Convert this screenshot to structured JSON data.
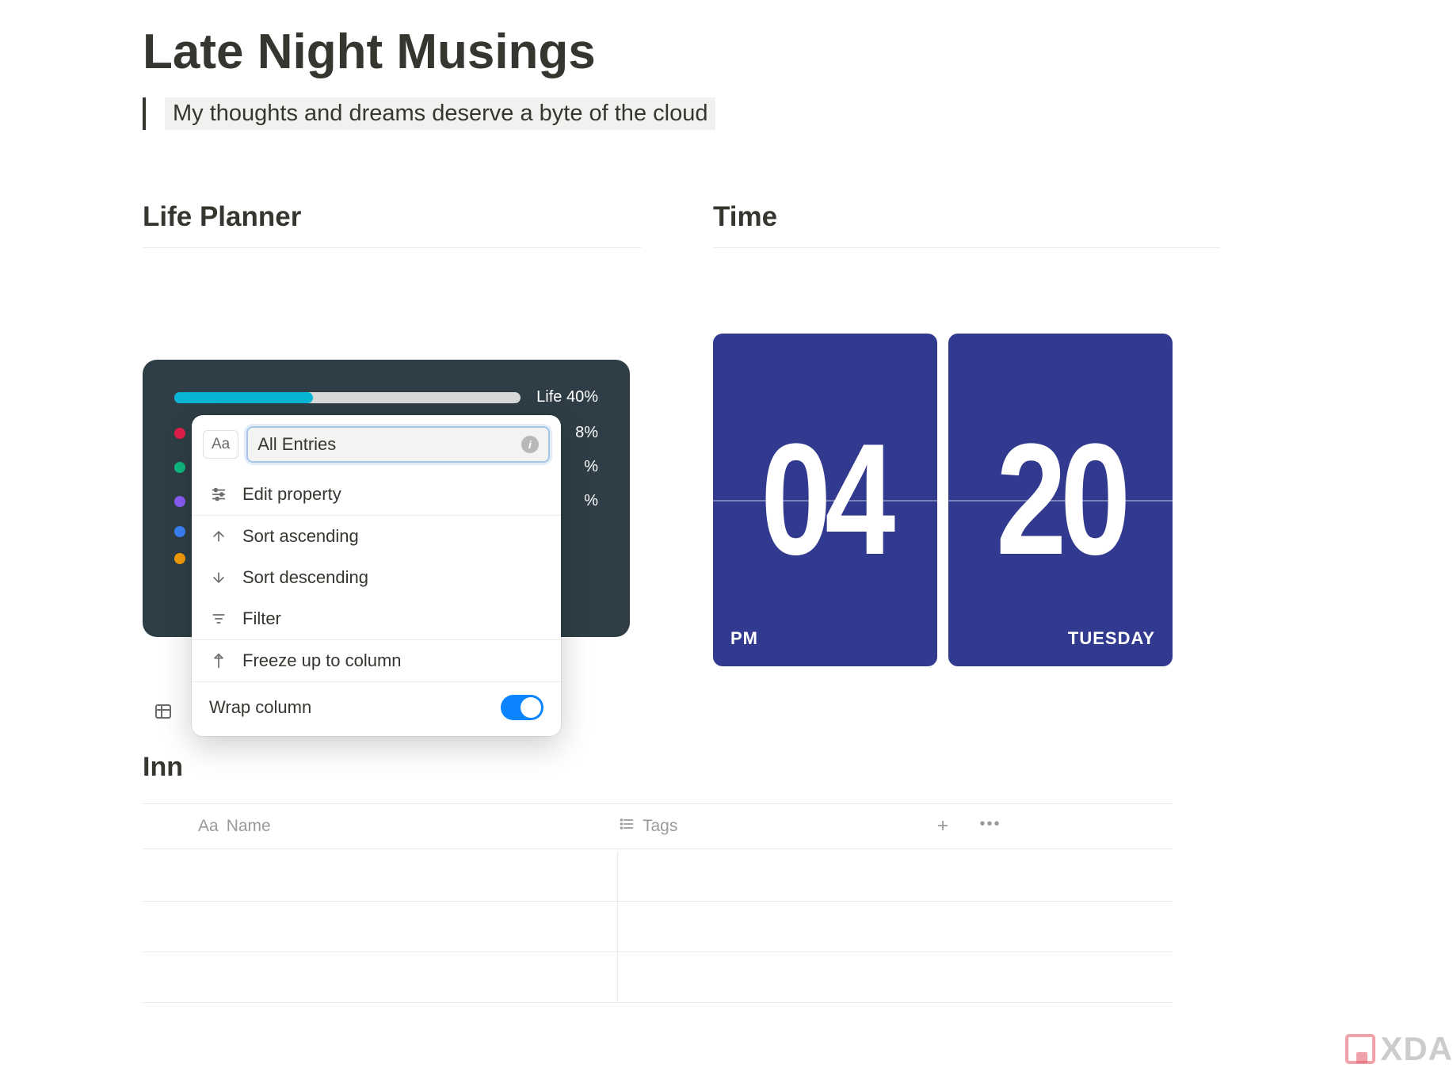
{
  "page": {
    "title": "Late Night Musings",
    "subtitle": "My thoughts and dreams deserve a byte of the cloud"
  },
  "sections": {
    "life_planner": "Life Planner",
    "time": "Time",
    "inbox_title": "Inn"
  },
  "life_widget": {
    "main_label": "Life 40%",
    "progress_pct": 40,
    "rows": [
      {
        "pct": "8%"
      },
      {
        "pct": "%"
      },
      {
        "pct": "%"
      }
    ]
  },
  "column_menu": {
    "type_label": "Aa",
    "input_value": "All Entries",
    "items": {
      "edit_property": "Edit property",
      "sort_asc": "Sort ascending",
      "sort_desc": "Sort descending",
      "filter": "Filter",
      "freeze": "Freeze up to column",
      "wrap": "Wrap column"
    },
    "wrap_enabled": true
  },
  "table": {
    "columns": {
      "name": "Name",
      "tags": "Tags"
    }
  },
  "clock": {
    "hour": "04",
    "minute": "20",
    "meridiem": "PM",
    "day": "TUESDAY"
  },
  "watermark": "XDA"
}
